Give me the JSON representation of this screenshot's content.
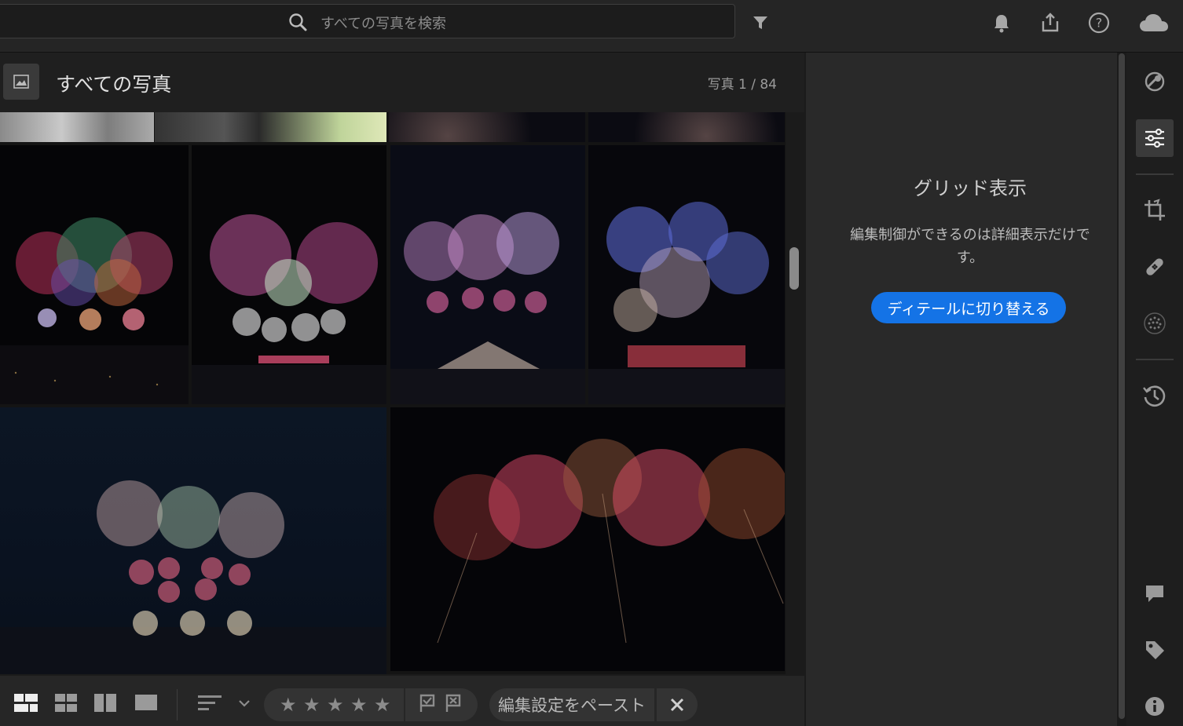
{
  "search": {
    "placeholder": "すべての写真を検索"
  },
  "header": {
    "title": "すべての写真",
    "count": "写真 1 / 84"
  },
  "right_panel": {
    "heading": "グリッド表示",
    "message": "編集制御ができるのは詳細表示だけです。",
    "button": "ディテールに切り替える"
  },
  "bottom_bar": {
    "stars": [
      "★",
      "★",
      "★",
      "★",
      "★"
    ],
    "paste_label": "編集設定をペースト"
  },
  "colors": {
    "accent": "#1473e6",
    "panel": "#292929",
    "background": "#1b1b1b"
  },
  "icons": {
    "top": [
      "search-icon",
      "filter-icon",
      "bell-icon",
      "share-icon",
      "help-icon",
      "cloud-icon"
    ],
    "bottom": [
      "photo-grid-icon",
      "square-grid-icon",
      "detail-view-icon",
      "single-view-icon",
      "sort-icon",
      "chevron-down-icon",
      "flag-pick-icon",
      "flag-reject-icon",
      "close-icon"
    ],
    "side": [
      "auto-adjust-icon",
      "edit-sliders-icon",
      "crop-icon",
      "healing-icon",
      "mask-icon",
      "history-icon",
      "comment-icon",
      "tag-icon",
      "info-icon"
    ]
  }
}
